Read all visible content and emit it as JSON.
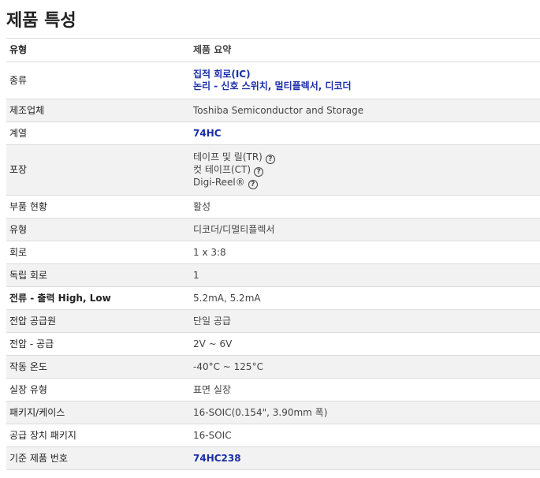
{
  "title": "제품 특성",
  "header": {
    "type_label": "유형",
    "summary_label": "제품 요약"
  },
  "rows": [
    {
      "label": "종류",
      "values": [
        "집적 회로(IC)",
        "논리 - 신호 스위치, 멀티플렉서, 디코더"
      ]
    },
    {
      "label": "제조업체",
      "value": "Toshiba Semiconductor and Storage"
    },
    {
      "label": "계열",
      "value": "74HC"
    },
    {
      "label": "포장",
      "values": [
        "테이프 및 릴(TR)",
        "컷 테이프(CT)",
        "Digi-Reel®"
      ]
    },
    {
      "label": "부품 현황",
      "value": "활성"
    },
    {
      "label": "유형",
      "value": "디코더/디멀티플렉서"
    },
    {
      "label": "회로",
      "value": "1 x 3:8"
    },
    {
      "label": "독립 회로",
      "value": "1"
    },
    {
      "label": "전류 - 출력 High, Low",
      "value": "5.2mA, 5.2mA"
    },
    {
      "label": "전압 공급원",
      "value": "단일 공급"
    },
    {
      "label": "전압 - 공급",
      "value": "2V ~ 6V"
    },
    {
      "label": "작동 온도",
      "value": "-40°C ~ 125°C"
    },
    {
      "label": "실장 유형",
      "value": "표면 실장"
    },
    {
      "label": "패키지/케이스",
      "value": "16-SOIC(0.154\", 3.90mm 폭)"
    },
    {
      "label": "공급 장치 패키지",
      "value": "16-SOIC"
    },
    {
      "label": "기준 제품 번호",
      "value": "74HC238"
    }
  ],
  "help_glyph": "?",
  "colors": {
    "link": "#1a2ea8",
    "row_shade": "#f2f2f2",
    "border": "#dcdcdc"
  },
  "icons": [
    "help-icon"
  ]
}
